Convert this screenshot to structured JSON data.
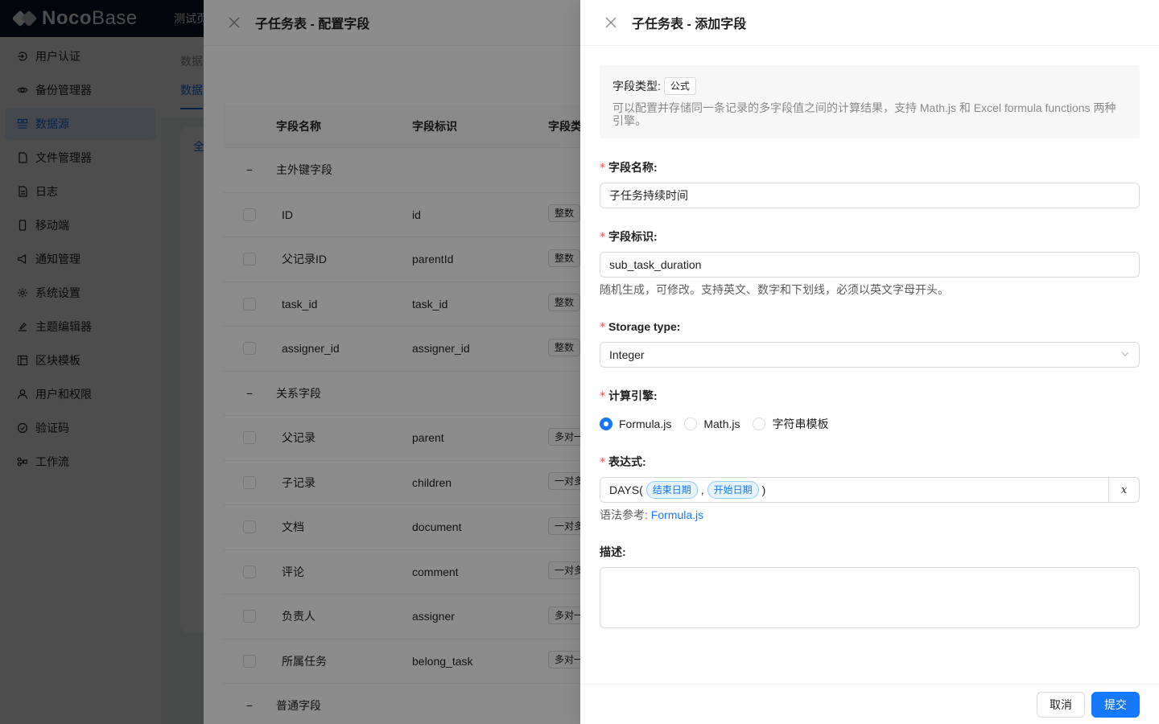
{
  "app": {
    "logo_bold": "Noco",
    "logo_light": "Base",
    "top_tab": "测试页"
  },
  "sidebar": {
    "items": [
      {
        "label": "用户认证",
        "icon": "login-icon"
      },
      {
        "label": "备份管理器",
        "icon": "eye-icon"
      },
      {
        "label": "数据源",
        "icon": "database-icon",
        "active": true
      },
      {
        "label": "文件管理器",
        "icon": "file-icon"
      },
      {
        "label": "日志",
        "icon": "file-text-icon"
      },
      {
        "label": "移动端",
        "icon": "mobile-icon"
      },
      {
        "label": "通知管理",
        "icon": "notification-icon"
      },
      {
        "label": "系统设置",
        "icon": "gear-icon"
      },
      {
        "label": "主题编辑器",
        "icon": "paint-icon"
      },
      {
        "label": "区块模板",
        "icon": "layout-icon"
      },
      {
        "label": "用户和权限",
        "icon": "user-icon"
      },
      {
        "label": "验证码",
        "icon": "check-circle-icon"
      },
      {
        "label": "工作流",
        "icon": "workflow-icon"
      }
    ]
  },
  "base": {
    "crumb": "数据",
    "tab": "数据",
    "card_pill": "全"
  },
  "drawer1": {
    "title": "子任务表 - 配置字段",
    "columns": {
      "name": "字段名称",
      "key": "字段标识",
      "type": "字段类"
    },
    "rows": [
      {
        "kind": "group",
        "name": "主外键字段"
      },
      {
        "kind": "row",
        "name": "ID",
        "key": "id",
        "type": "整数"
      },
      {
        "kind": "row",
        "name": "父记录ID",
        "key": "parentId",
        "type": "整数"
      },
      {
        "kind": "row",
        "name": "task_id",
        "key": "task_id",
        "type": "整数"
      },
      {
        "kind": "row",
        "name": "assigner_id",
        "key": "assigner_id",
        "type": "整数"
      },
      {
        "kind": "group",
        "name": "关系字段"
      },
      {
        "kind": "row",
        "name": "父记录",
        "key": "parent",
        "type": "多对一"
      },
      {
        "kind": "row",
        "name": "子记录",
        "key": "children",
        "type": "一对多"
      },
      {
        "kind": "row",
        "name": "文档",
        "key": "document",
        "type": "一对多"
      },
      {
        "kind": "row",
        "name": "评论",
        "key": "comment",
        "type": "一对多"
      },
      {
        "kind": "row",
        "name": "负责人",
        "key": "assigner",
        "type": "多对一"
      },
      {
        "kind": "row",
        "name": "所属任务",
        "key": "belong_task",
        "type": "多对一"
      },
      {
        "kind": "group",
        "name": "普通字段"
      }
    ]
  },
  "drawer2": {
    "title": "子任务表 - 添加字段",
    "info": {
      "type_label": "字段类型:",
      "type_value": "公式",
      "description": "可以配置并存储同一条记录的多字段值之间的计算结果，支持 Math.js 和 Excel formula functions 两种引擎。"
    },
    "field_name": {
      "label": "字段名称:",
      "value": "子任务持续时间"
    },
    "field_key": {
      "label": "字段标识:",
      "value": "sub_task_duration",
      "help": "随机生成，可修改。支持英文、数字和下划线，必须以英文字母开头。"
    },
    "storage_type": {
      "label": "Storage type:",
      "value": "Integer"
    },
    "engine": {
      "label": "计算引擎:",
      "options": [
        {
          "label": "Formula.js",
          "checked": true
        },
        {
          "label": "Math.js",
          "checked": false
        },
        {
          "label": "字符串模板",
          "checked": false
        }
      ]
    },
    "expression": {
      "label": "表达式:",
      "prefix": "DAYS(",
      "var1": "结束日期",
      "comma": ",",
      "var2": "开始日期",
      "suffix": ")",
      "var_button": "x",
      "syntax_label": "语法参考:",
      "syntax_link": "Formula.js"
    },
    "description": {
      "label": "描述:"
    },
    "footer": {
      "cancel": "取消",
      "submit": "提交"
    }
  }
}
